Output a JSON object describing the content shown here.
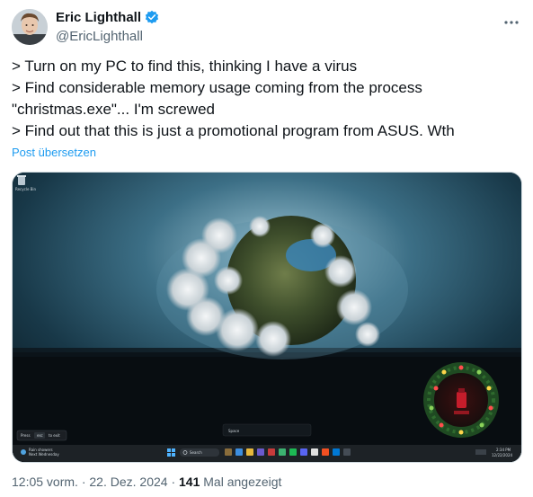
{
  "author": {
    "name": "Eric Lighthall",
    "handle": "@EricLighthall",
    "verified": true
  },
  "tweet": {
    "lines": [
      "> Turn on my PC to find this, thinking I have a virus",
      "> Find considerable memory usage coming from the process",
      "\"christmas.exe\"... I'm screwed",
      "> Find out that this is just a promotional program from ASUS. Wth"
    ],
    "translate_label": "Post übersetzen"
  },
  "media": {
    "desktop_icon_label": "Recycle Bin",
    "esc_hint": {
      "press": "Press",
      "key": "esc",
      "suffix": "to exit"
    },
    "search_box": "Space",
    "taskbar": {
      "search_label": "Search",
      "weather_title": "Rain showers",
      "weather_sub": "Next Wednesday",
      "time": "2:34 PM",
      "date": "12/22/2024"
    }
  },
  "footer": {
    "time": "12:05 vorm.",
    "separator": "·",
    "date": "22. Dez. 2024",
    "views_count": "141",
    "views_label": "Mal angezeigt"
  },
  "colors": {
    "link": "#1d9bf0",
    "secondary_text": "#536471",
    "verified_badge": "#1d9bf0"
  },
  "icons": [
    "verified-badge-icon",
    "more-options-icon",
    "recycle-bin-icon",
    "windows-start-icon",
    "search-icon"
  ]
}
